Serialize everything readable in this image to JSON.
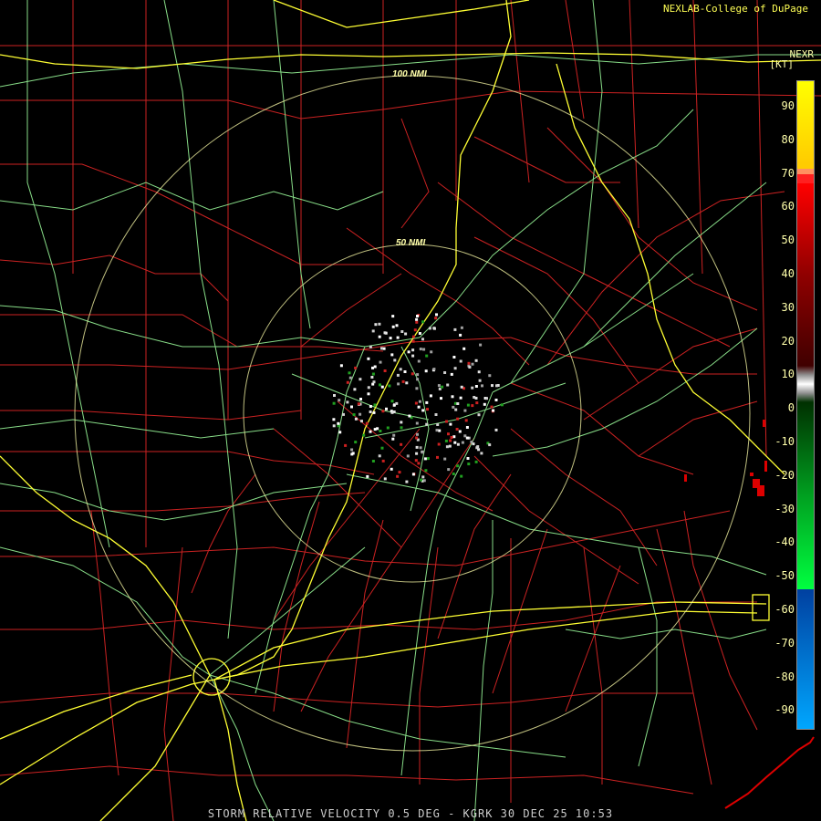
{
  "header": {
    "credit": "NEXLAB-College of DuPage",
    "product": "NEXR",
    "units": "[KT]"
  },
  "footer": {
    "caption": "STORM RELATIVE VELOCITY 0.5 DEG - KGRK 30 DEC 25 10:53"
  },
  "range_rings": [
    "100 NMI",
    "50 NMI"
  ],
  "legend": {
    "ticks": [
      "90",
      "80",
      "70",
      "60",
      "50",
      "40",
      "30",
      "20",
      "10",
      "0",
      "-10",
      "-20",
      "-30",
      "-40",
      "-50",
      "-60",
      "-70",
      "-80",
      "-90"
    ],
    "colors": [
      "#ffff00",
      "#ffd000",
      "#ff9060",
      "#ff0000",
      "#b00000",
      "#700000",
      "#a0a0a0",
      "#ffffff",
      "#005000",
      "#00b000",
      "#00ff40",
      "#0050c0",
      "#00a8ff"
    ]
  },
  "colors": {
    "county_lines": "#cc2222",
    "highways": "#ffff33",
    "roads": "#88dd88",
    "rings": "#ffffaa"
  }
}
